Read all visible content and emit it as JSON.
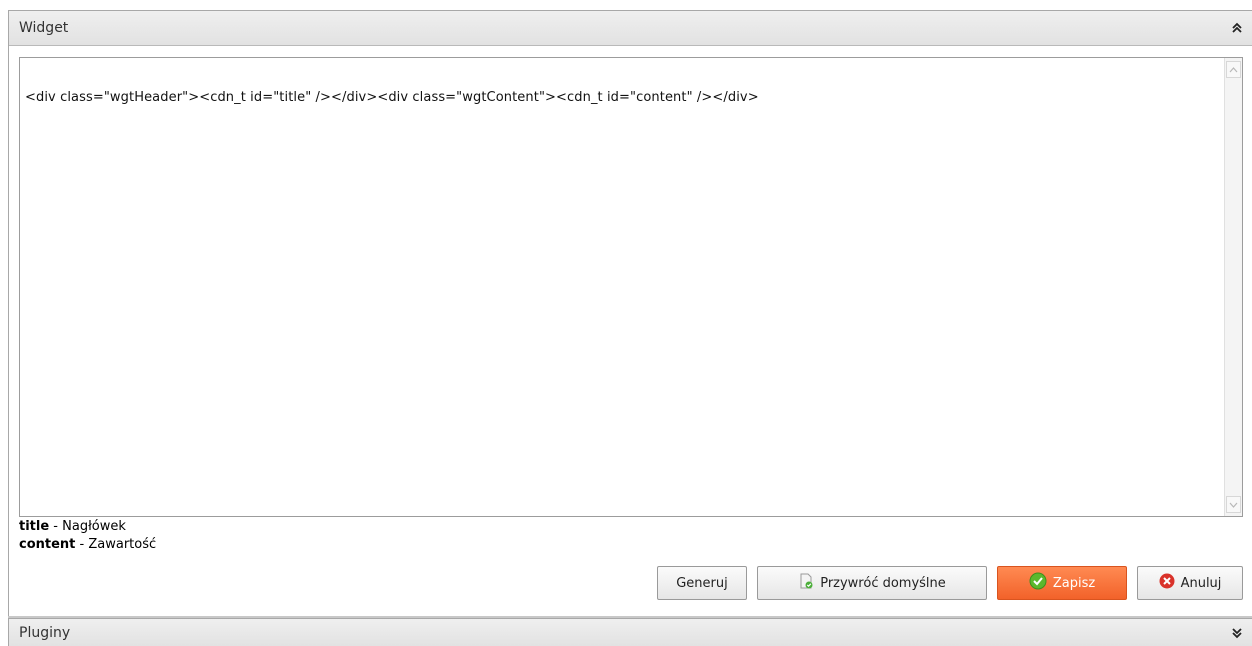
{
  "widget_panel": {
    "title": "Widget",
    "collapse_icon": "double-chevron-up-icon"
  },
  "editor": {
    "content": "<div class=\"wgtHeader\"><cdn_t id=\"title\" /></div><div class=\"wgtContent\"><cdn_t id=\"content\" /></div>"
  },
  "legend": [
    {
      "key": "title",
      "desc": " - Nagłówek"
    },
    {
      "key": "content",
      "desc": " - Zawartość"
    }
  ],
  "buttons": {
    "generate": "Generuj",
    "restore_default": "Przywróć domyślne",
    "save": "Zapisz",
    "cancel": "Anuluj"
  },
  "plugins_panel": {
    "title": "Pluginy",
    "expand_icon": "double-chevron-down-icon"
  },
  "colors": {
    "save_button": "#f2622a",
    "check_icon": "#5cb82d",
    "cancel_icon": "#d9322a"
  }
}
